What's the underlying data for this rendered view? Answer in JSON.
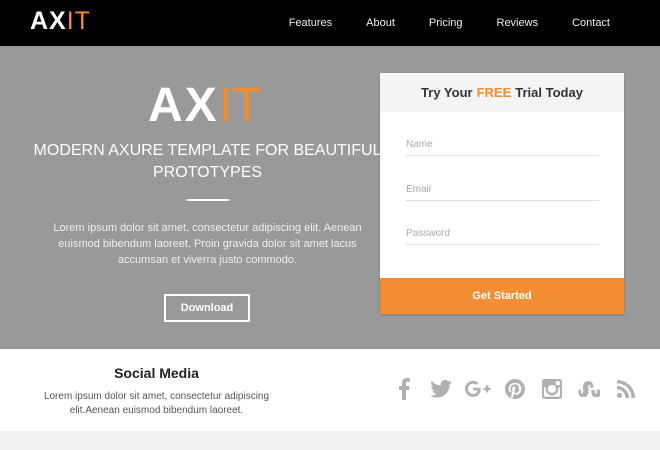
{
  "brand": {
    "ax": "AX",
    "it": "IT"
  },
  "nav": {
    "items": [
      {
        "label": "Features"
      },
      {
        "label": "About"
      },
      {
        "label": "Pricing"
      },
      {
        "label": "Reviews"
      },
      {
        "label": "Contact"
      }
    ]
  },
  "hero": {
    "logo_ax": "AX",
    "logo_it": "IT",
    "title": "MODERN AXURE TEMPLATE FOR BEAUTIFUL PROTOTYPES",
    "text": "Lorem ipsum dolor sit amet, consectetur adipiscing elit. Aenean euismod bibendum laoreet. Proin gravida dolor sit amet lacus accumsan et viverra justo commodo.",
    "download_label": "Download"
  },
  "trial": {
    "title_before": "Try Your",
    "title_free": "FREE",
    "title_after": "Trial Today",
    "name_placeholder": "Name",
    "email_placeholder": "Email",
    "password_placeholder": "Password",
    "submit_label": "Get Started"
  },
  "social": {
    "title": "Social Media",
    "text": "Lorem ipsum dolor sit amet, consectetur adipiscing elit.Aenean euismod bibendum laoreet.",
    "icons": [
      "facebook-icon",
      "twitter-icon",
      "google-plus-icon",
      "pinterest-icon",
      "instagram-icon",
      "stumbleupon-icon",
      "rss-icon"
    ]
  },
  "colors": {
    "accent": "#f28c2c",
    "hero_bg": "#999999",
    "topbar_bg": "#000000",
    "button_orange": "#f48e34"
  }
}
